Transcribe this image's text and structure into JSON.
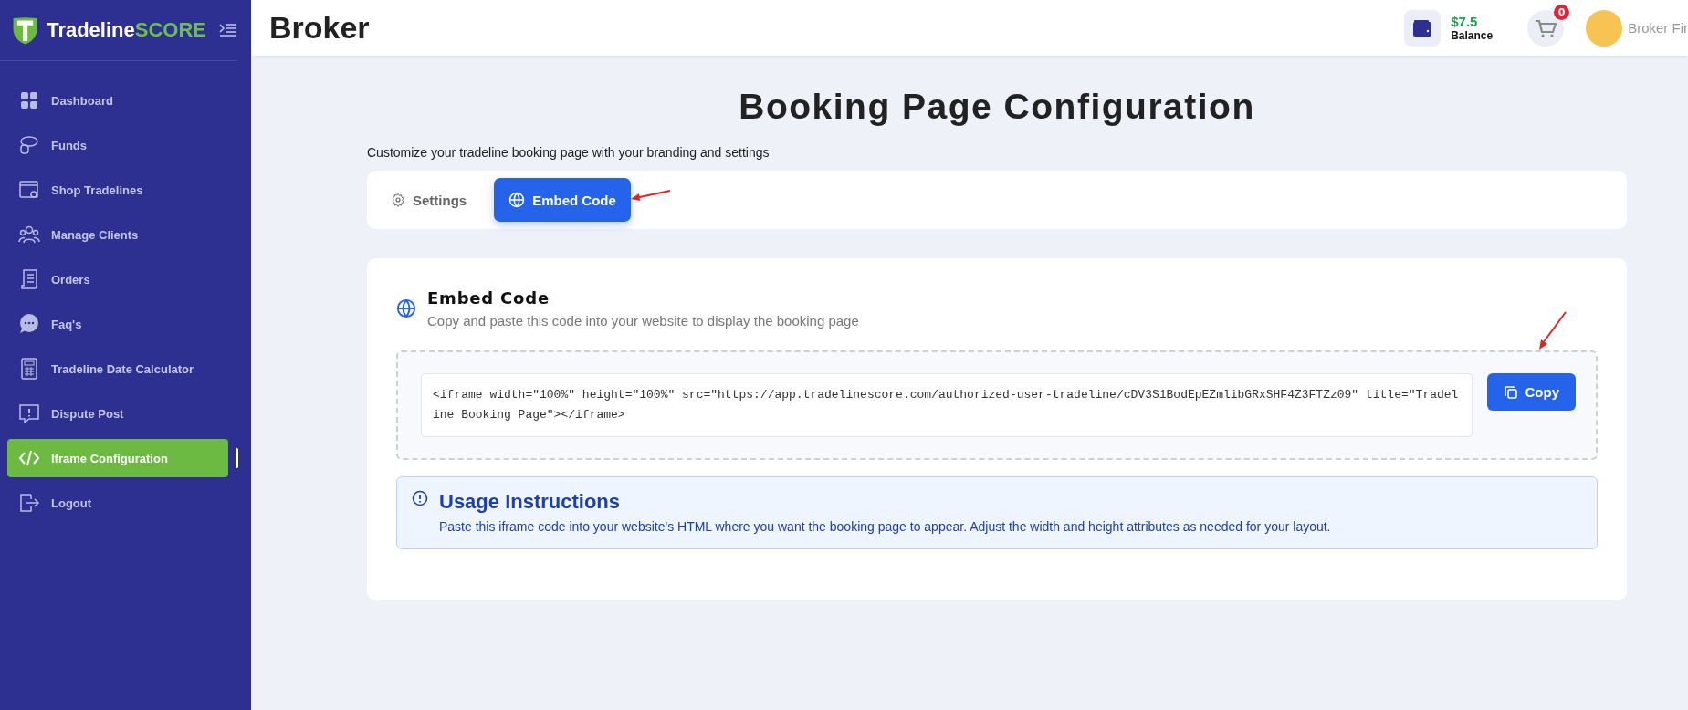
{
  "brand": {
    "name_part_1": "Tradeline",
    "name_part_2": "SCORE"
  },
  "sidebar": {
    "items": [
      {
        "label": "Dashboard",
        "selected": false
      },
      {
        "label": "Funds",
        "selected": false
      },
      {
        "label": "Shop Tradelines",
        "selected": false
      },
      {
        "label": "Manage Clients",
        "selected": false
      },
      {
        "label": "Orders",
        "selected": false
      },
      {
        "label": "Faq's",
        "selected": false
      },
      {
        "label": "Tradeline Date Calculator",
        "selected": false
      },
      {
        "label": "Dispute Post",
        "selected": false
      },
      {
        "label": "Iframe Configuration",
        "selected": true
      },
      {
        "label": "Logout",
        "selected": false
      }
    ]
  },
  "header": {
    "title": "Broker",
    "balance_amount": "$7.5",
    "balance_label": "Balance",
    "cart_count": "0",
    "user_name": "Broker Fir"
  },
  "page": {
    "title": "Booking Page Configuration",
    "subtitle": "Customize your tradeline booking page with your branding and settings"
  },
  "tabs": [
    {
      "label": "Settings",
      "selected": false
    },
    {
      "label": "Embed Code",
      "selected": true
    }
  ],
  "embed": {
    "title": "Embed Code",
    "description": "Copy and paste this code into your website to display the booking page",
    "code": "<iframe width=\"100%\" height=\"100%\" src=\"https://app.tradelinescore.com/authorized-user-tradeline/cDV3S1BodEpEZmlibGRxSHF4Z3FTZz09\" title=\"Tradeline Booking Page\"></iframe>",
    "copy_button": "Copy"
  },
  "instructions": {
    "title": "Usage Instructions",
    "text": "Paste this iframe code into your website's HTML where you want the booking page to appear. Adjust the width and height attributes as needed for your layout."
  }
}
